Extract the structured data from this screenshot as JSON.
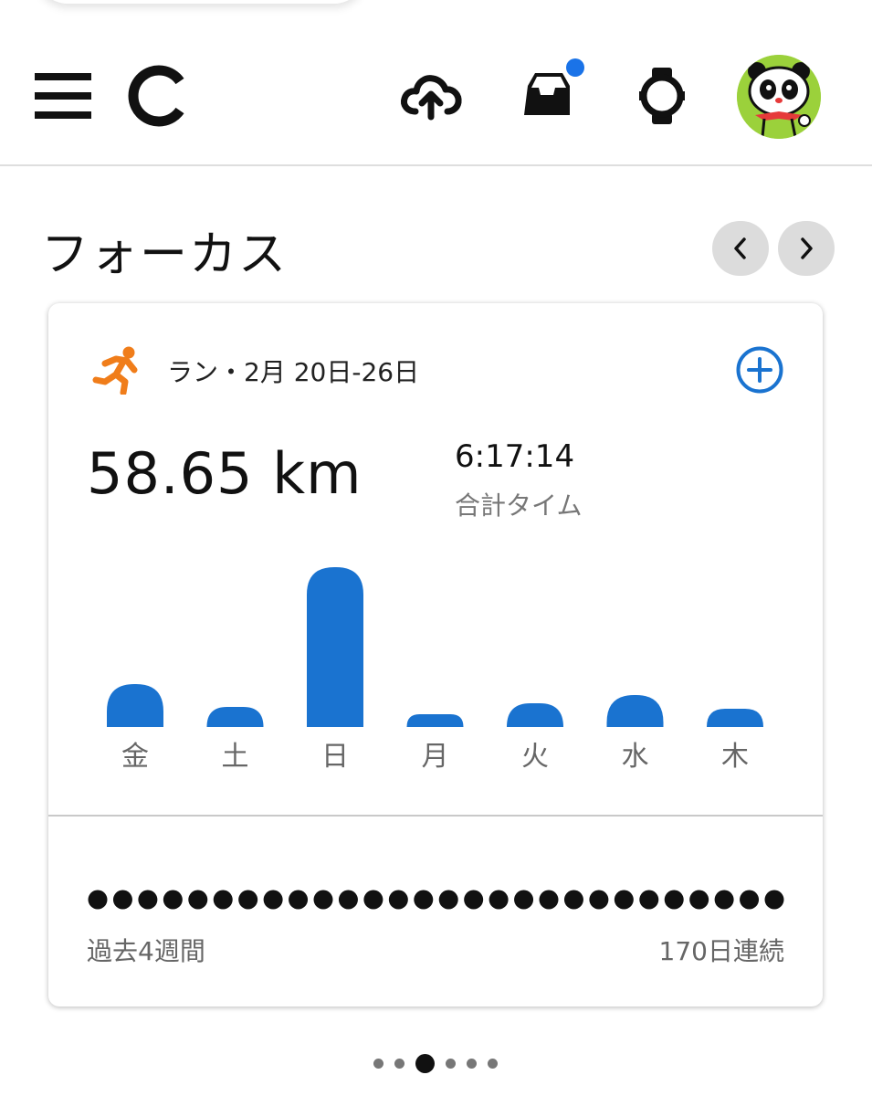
{
  "header": {
    "menu_icon": "hamburger-menu-icon",
    "logo_icon": "garmin-connect-logo-icon",
    "sync_icon": "cloud-upload-icon",
    "inbox_icon": "inbox-tray-icon",
    "inbox_badge_color": "#1a73e8",
    "device_icon": "watch-icon",
    "avatar_icon": "panda-avatar-icon"
  },
  "section": {
    "title": "フォーカス",
    "prev_icon": "chevron-left-icon",
    "next_icon": "chevron-right-icon"
  },
  "card": {
    "activity_icon": "running-person-icon",
    "activity_icon_color": "#f07d1a",
    "label": "ラン・2月 20日-26日",
    "add_icon": "plus-circle-icon",
    "accent_color": "#1a73d0",
    "distance": "58.65 km",
    "total_time": "6:17:14",
    "total_time_label": "合計タイム",
    "streak_left": "過去4週間",
    "streak_right": "170日連続",
    "streak_day_count": 28
  },
  "chart_data": {
    "type": "bar",
    "categories": [
      "金",
      "土",
      "日",
      "月",
      "火",
      "水",
      "木"
    ],
    "values": [
      4.7,
      2.2,
      17.5,
      1.4,
      2.6,
      3.5,
      2.0
    ],
    "ylim": [
      0,
      18
    ],
    "bar_color": "#1a73d0",
    "grid": false
  },
  "pager": {
    "count": 6,
    "active_index": 2
  }
}
